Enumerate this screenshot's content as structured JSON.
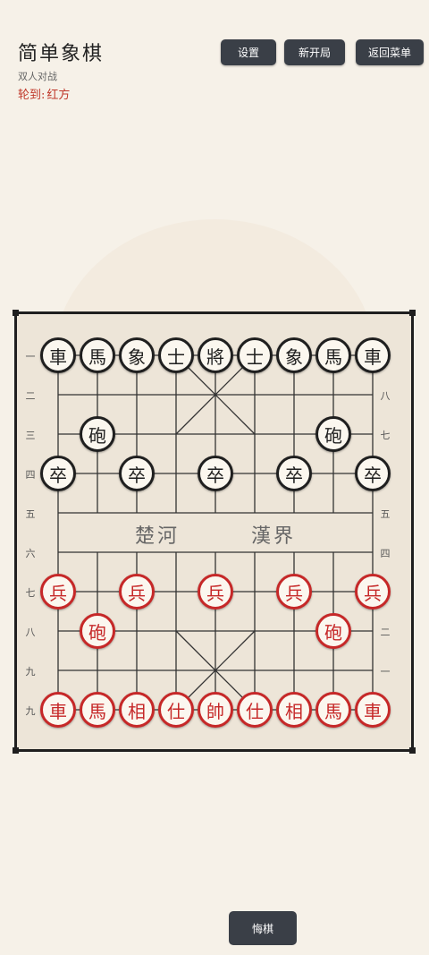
{
  "header": {
    "title": "简单象棋",
    "subtitle": "双人对战",
    "turn_label": "轮到:",
    "turn_value": "红方"
  },
  "buttons": {
    "settings": "设置",
    "new_game": "新开局",
    "back_menu": "返回菜单",
    "undo": "悔棋"
  },
  "board": {
    "river_left": "楚河",
    "river_right": "漢界",
    "left_numbers": [
      "一",
      "二",
      "三",
      "四",
      "五",
      "六",
      "七",
      "八",
      "九",
      "九"
    ],
    "right_numbers": [
      "八",
      "七",
      "五",
      "四",
      "二",
      "一"
    ],
    "black_pieces": [
      {
        "char": "車",
        "col": 0,
        "row": 0
      },
      {
        "char": "馬",
        "col": 1,
        "row": 0
      },
      {
        "char": "象",
        "col": 2,
        "row": 0
      },
      {
        "char": "士",
        "col": 3,
        "row": 0
      },
      {
        "char": "將",
        "col": 4,
        "row": 0
      },
      {
        "char": "士",
        "col": 5,
        "row": 0
      },
      {
        "char": "象",
        "col": 6,
        "row": 0
      },
      {
        "char": "馬",
        "col": 7,
        "row": 0
      },
      {
        "char": "車",
        "col": 8,
        "row": 0
      },
      {
        "char": "砲",
        "col": 1,
        "row": 2
      },
      {
        "char": "砲",
        "col": 7,
        "row": 2
      },
      {
        "char": "卒",
        "col": 0,
        "row": 3
      },
      {
        "char": "卒",
        "col": 2,
        "row": 3
      },
      {
        "char": "卒",
        "col": 4,
        "row": 3
      },
      {
        "char": "卒",
        "col": 6,
        "row": 3
      },
      {
        "char": "卒",
        "col": 8,
        "row": 3
      }
    ],
    "red_pieces": [
      {
        "char": "兵",
        "col": 0,
        "row": 6
      },
      {
        "char": "兵",
        "col": 2,
        "row": 6
      },
      {
        "char": "兵",
        "col": 4,
        "row": 6
      },
      {
        "char": "兵",
        "col": 6,
        "row": 6
      },
      {
        "char": "兵",
        "col": 8,
        "row": 6
      },
      {
        "char": "砲",
        "col": 1,
        "row": 7
      },
      {
        "char": "砲",
        "col": 7,
        "row": 7
      },
      {
        "char": "車",
        "col": 0,
        "row": 9
      },
      {
        "char": "馬",
        "col": 1,
        "row": 9
      },
      {
        "char": "相",
        "col": 2,
        "row": 9
      },
      {
        "char": "仕",
        "col": 3,
        "row": 9
      },
      {
        "char": "帥",
        "col": 4,
        "row": 9
      },
      {
        "char": "仕",
        "col": 5,
        "row": 9
      },
      {
        "char": "相",
        "col": 6,
        "row": 9
      },
      {
        "char": "馬",
        "col": 7,
        "row": 9
      },
      {
        "char": "車",
        "col": 8,
        "row": 9
      }
    ],
    "colors": {
      "red": "#c62828",
      "black": "#1f1f1f",
      "board": "#ede5d8"
    }
  }
}
